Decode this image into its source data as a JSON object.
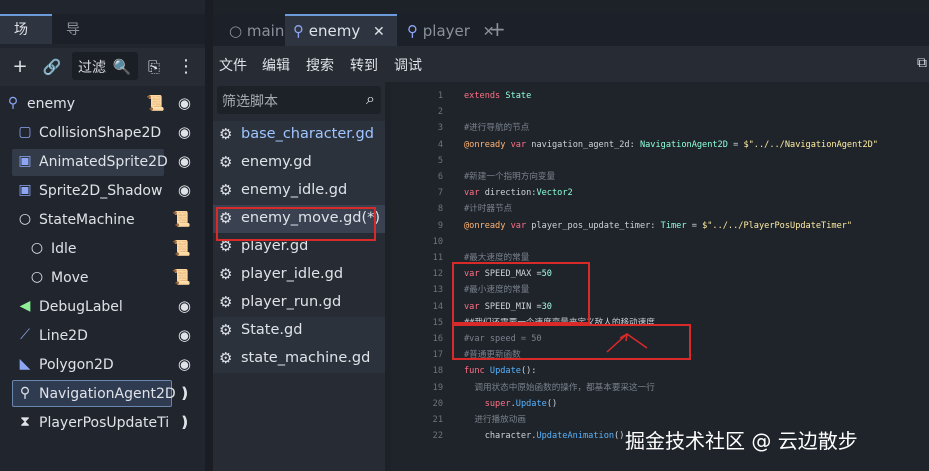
{
  "dock": {
    "tabs": [
      "场景",
      "导入"
    ],
    "filter_placeholder": "过滤"
  },
  "tree": {
    "nodes": [
      {
        "label": "enemy",
        "icon": "node2d-icon",
        "action": "script-icon"
      },
      {
        "label": "CollisionShape2D",
        "icon": "collision-shape-icon",
        "action": "eye-icon"
      },
      {
        "label": "AnimatedSprite2D",
        "icon": "animated-sprite-icon",
        "action": "eye-icon"
      },
      {
        "label": "Sprite2D_Shadow",
        "icon": "sprite-icon",
        "action": "eye-icon"
      },
      {
        "label": "StateMachine",
        "icon": "node-icon",
        "action": "script-icon"
      },
      {
        "label": "Idle",
        "icon": "node-icon",
        "action": "script-icon"
      },
      {
        "label": "Move",
        "icon": "node-icon",
        "action": "script-icon"
      },
      {
        "label": "DebugLabel",
        "icon": "label-icon",
        "action": "eye-icon"
      },
      {
        "label": "Line2D",
        "icon": "line2d-icon",
        "action": "eye-icon"
      },
      {
        "label": "Polygon2D",
        "icon": "polygon-icon",
        "action": "eye-icon"
      },
      {
        "label": "NavigationAgent2D",
        "icon": "navigation-pin-icon",
        "action": "signal-icon"
      },
      {
        "label": "PlayerPosUpdateTi",
        "icon": "timer-icon",
        "action": "signal-icon"
      }
    ]
  },
  "editor_tabs": [
    {
      "label": "main",
      "icon": "circle-icon"
    },
    {
      "label": "enemy",
      "icon": "node2d-icon",
      "close": "✕"
    },
    {
      "label": "player",
      "icon": "node2d-icon",
      "close": "✕"
    }
  ],
  "menu": [
    "文件",
    "编辑",
    "搜索",
    "转到",
    "调试"
  ],
  "scripts": {
    "search_placeholder": "筛选脚本",
    "items": [
      "base_character.gd",
      "enemy.gd",
      "enemy_idle.gd",
      "enemy_move.gd(*)",
      "player.gd",
      "player_idle.gd",
      "player_run.gd",
      "State.gd",
      "state_machine.gd"
    ]
  },
  "code_lines": [
    {
      "n": "1",
      "html": "<span class=\"kw\">extends</span> <span class=\"ty\">State</span>"
    },
    {
      "n": "2",
      "html": ""
    },
    {
      "n": "3",
      "html": "<span class=\"cm\">#进行导航的节点</span>"
    },
    {
      "n": "4",
      "html": "<span class=\"an\">@onready</span> <span class=\"kw\">var</span> navigation_agent_2d: <span class=\"ty\">NavigationAgent2D</span> = <span class=\"str\">$\"../../NavigationAgent2D\"</span>"
    },
    {
      "n": "5",
      "html": ""
    },
    {
      "n": "6",
      "html": "<span class=\"cm\">#新建一个指明方向变量</span>"
    },
    {
      "n": "7",
      "html": "<span class=\"kw\">var</span> direction:<span class=\"ty\">Vector2</span>"
    },
    {
      "n": "8",
      "html": "<span class=\"cm\">#计时器节点</span>"
    },
    {
      "n": "9",
      "html": "<span class=\"an\">@onready</span> <span class=\"kw\">var</span> player_pos_update_timer: <span class=\"ty\">Timer</span> = <span class=\"str\">$\"../../PlayerPosUpdateTimer\"</span>"
    },
    {
      "n": "10",
      "html": ""
    },
    {
      "n": "11",
      "html": "<span class=\"cm\">#最大速度的常量</span>"
    },
    {
      "n": "12",
      "html": "<span class=\"kw\">var</span> SPEED_MAX =<span class=\"num-lit\">50</span>"
    },
    {
      "n": "13",
      "html": "<span class=\"cm\">#最小速度的常量</span>"
    },
    {
      "n": "14",
      "html": "<span class=\"kw\">var</span> SPEED_MIN =<span class=\"num-lit\">30</span>"
    },
    {
      "n": "15",
      "html": "##我们还需要一个速度变量来定义敌人的移动速度"
    },
    {
      "n": "16",
      "html": "<span class=\"cm\">#var speed = 50</span>"
    },
    {
      "n": "17",
      "html": "<span class=\"cm\">#普通更新函数</span>"
    },
    {
      "n": "18",
      "html": "<span class=\"kw\">func</span> <span class=\"fn\">Update</span>():"
    },
    {
      "n": "19",
      "html": "<span class=\"cm\">  调用状态中原始函数的操作，都基本要采这一行</span>"
    },
    {
      "n": "20",
      "html": "    <span class=\"kw\">super</span>.<span class=\"fn\">Update</span>()"
    },
    {
      "n": "21",
      "html": "<span class=\"cm\">  进行播放动画</span>"
    },
    {
      "n": "22",
      "html": "    character.<span class=\"fn\">UpdateAnimation</span>()"
    }
  ],
  "watermark": "掘金技术社区 @ 云边散步"
}
